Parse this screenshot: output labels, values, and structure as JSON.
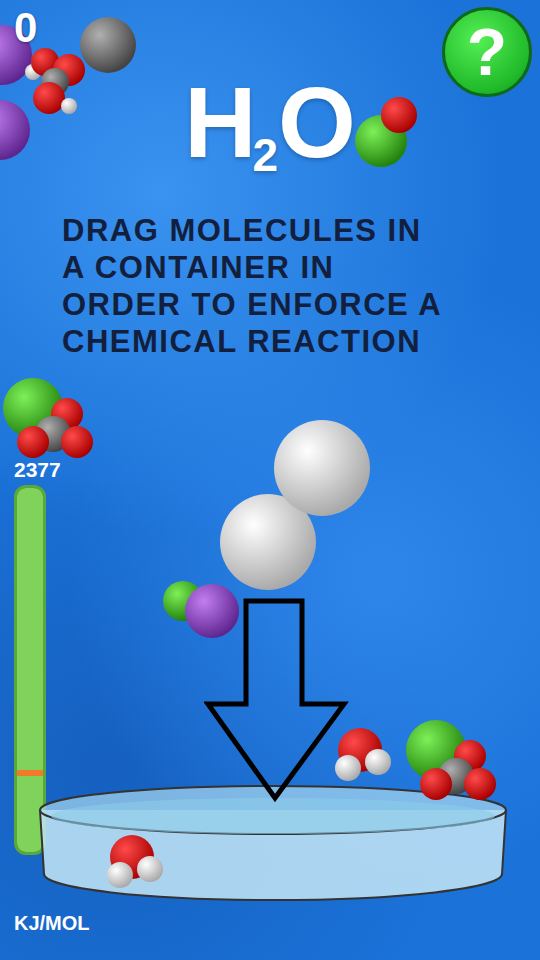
{
  "score": "0",
  "help_button": {
    "label": "?"
  },
  "title": {
    "main": "H",
    "subscript": "2",
    "tail": "O"
  },
  "instructions": [
    "DRAG MOLECULES IN",
    "A CONTAINER IN",
    "ORDER TO ENFORCE A",
    "CHEMICAL REACTION"
  ],
  "energy": {
    "reading": "2377",
    "unit": "KJ/MOL",
    "level": 1,
    "marker": 0.21
  },
  "molecules": [
    {
      "kind": "sodium"
    },
    {
      "kind": "cluster"
    },
    {
      "kind": "carbon"
    },
    {
      "kind": "sodium"
    },
    {
      "kind": "clo"
    },
    {
      "kind": "chlorate"
    },
    {
      "kind": "h2"
    },
    {
      "kind": "nacl"
    },
    {
      "kind": "h2o"
    },
    {
      "kind": "chlorate"
    },
    {
      "kind": "h2o"
    }
  ]
}
